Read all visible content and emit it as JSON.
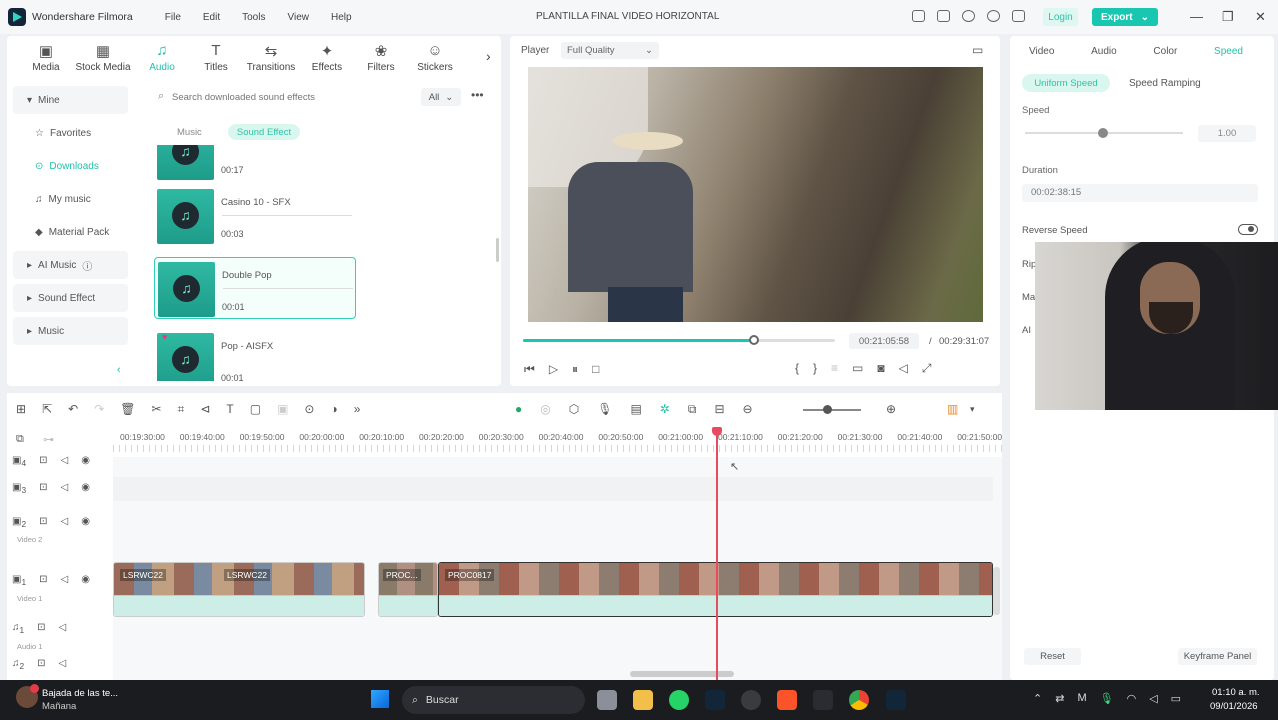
{
  "app": {
    "name": "Wondershare Filmora",
    "doc_title": "PLANTILLA FINAL VIDEO HORIZONTAL",
    "login": "Login",
    "export": "Export"
  },
  "menu": [
    "File",
    "Edit",
    "Tools",
    "View",
    "Help"
  ],
  "toolbar": [
    {
      "label": "Media",
      "icon": "media-icon"
    },
    {
      "label": "Stock Media",
      "icon": "stock-media-icon"
    },
    {
      "label": "Audio",
      "icon": "audio-icon"
    },
    {
      "label": "Titles",
      "icon": "titles-icon"
    },
    {
      "label": "Transitions",
      "icon": "transitions-icon"
    },
    {
      "label": "Effects",
      "icon": "effects-icon"
    },
    {
      "label": "Filters",
      "icon": "filters-icon"
    },
    {
      "label": "Stickers",
      "icon": "stickers-icon"
    }
  ],
  "sidebar": {
    "mine": "Mine",
    "items": [
      "Favorites",
      "Downloads",
      "My music",
      "Material Pack"
    ],
    "groups": [
      "AI Music",
      "Sound Effect",
      "Music"
    ]
  },
  "library": {
    "search_placeholder": "Search downloaded sound effects",
    "filter": "All",
    "subtabs": [
      "Music",
      "Sound Effect"
    ],
    "sounds": [
      {
        "name": "",
        "duration": "00:17"
      },
      {
        "name": "Casino 10 - SFX",
        "duration": "00:03"
      },
      {
        "name": "Double Pop",
        "duration": "00:01"
      },
      {
        "name": "Pop - AISFX",
        "duration": "00:01"
      }
    ]
  },
  "player": {
    "label": "Player",
    "quality": "Full Quality",
    "current": "00:21:05:58",
    "total": "00:29:31:07",
    "progress": 0.74
  },
  "inspector": {
    "tabs": [
      "Video",
      "Audio",
      "Color",
      "Speed"
    ],
    "modes": [
      "Uniform Speed",
      "Speed Ramping"
    ],
    "speed_label": "Speed",
    "speed_value": "1.00",
    "duration_label": "Duration",
    "duration_value": "00:02:38:15",
    "reverse_label": "Reverse Speed",
    "partial_labels": [
      "Rip",
      "Ma",
      "AI"
    ],
    "reset": "Reset",
    "keyframe": "Keyframe Panel"
  },
  "timeline": {
    "ticks": [
      "00:19:30:00",
      "00:19:40:00",
      "00:19:50:00",
      "00:20:00:00",
      "00:20:10:00",
      "00:20:20:00",
      "00:20:30:00",
      "00:20:40:00",
      "00:20:50:00",
      "00:21:00:00",
      "00:21:10:00",
      "00:21:20:00",
      "00:21:30:00",
      "00:21:40:00",
      "00:21:50:00"
    ],
    "tracks": [
      {
        "num": "4",
        "label": ""
      },
      {
        "num": "3",
        "label": ""
      },
      {
        "num": "2",
        "label": "Video 2"
      },
      {
        "num": "1",
        "label": "Video 1"
      },
      {
        "num": "1",
        "label": "Audio 1"
      },
      {
        "num": "2",
        "label": ""
      }
    ],
    "clips": [
      "LSRWC22",
      "LSRWC22",
      "PROC...",
      "PROC0817"
    ]
  },
  "taskbar": {
    "notification_title": "Bajada de las te...",
    "notification_sub": "Mañana",
    "search": "Buscar",
    "time": "01:10 a. m.",
    "date": "09/01/2026"
  },
  "colors": {
    "accent": "#21c2aa",
    "playhead": "#e84a5f",
    "export": "#19c7b0"
  }
}
